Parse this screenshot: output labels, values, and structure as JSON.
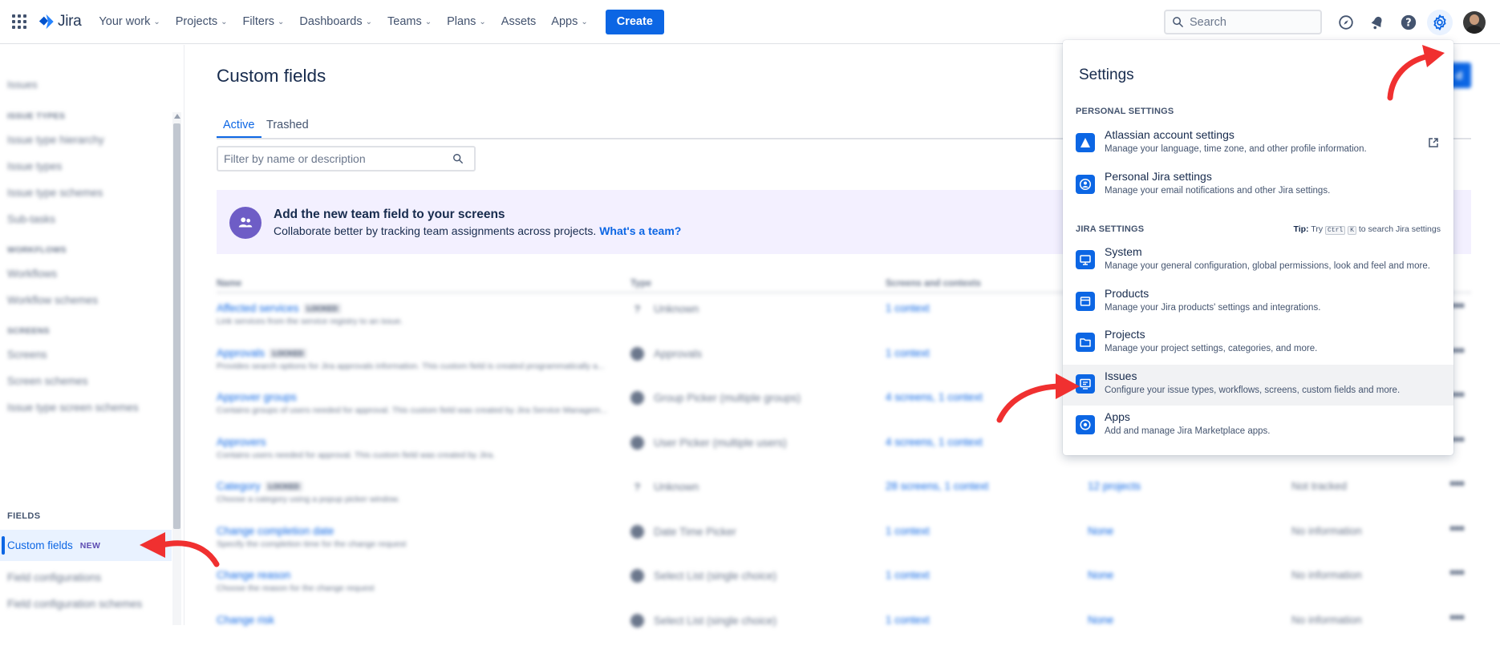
{
  "topnav": {
    "logo_text": "Jira",
    "items": [
      {
        "label": "Your work",
        "chevron": true
      },
      {
        "label": "Projects",
        "chevron": true
      },
      {
        "label": "Filters",
        "chevron": true
      },
      {
        "label": "Dashboards",
        "chevron": true
      },
      {
        "label": "Teams",
        "chevron": true
      },
      {
        "label": "Plans",
        "chevron": true
      },
      {
        "label": "Assets",
        "chevron": false
      },
      {
        "label": "Apps",
        "chevron": true
      }
    ],
    "create_label": "Create",
    "search_placeholder": "Search"
  },
  "sidebar": {
    "title": "Issues",
    "groups": [
      {
        "label": "ISSUE TYPES",
        "links": [
          "Issue type hierarchy",
          "Issue types",
          "Issue type schemes",
          "Sub-tasks"
        ]
      },
      {
        "label": "WORKFLOWS",
        "links": [
          "Workflows",
          "Workflow schemes"
        ]
      },
      {
        "label": "SCREENS",
        "links": [
          "Screens",
          "Screen schemes",
          "Issue type screen schemes"
        ]
      }
    ],
    "fields_label": "FIELDS",
    "active_label": "Custom fields",
    "active_badge": "NEW",
    "after_links": [
      "Field configurations",
      "Field configuration schemes"
    ]
  },
  "main": {
    "title": "Custom fields",
    "tabs": [
      "Active",
      "Trashed"
    ],
    "filter_placeholder": "Filter by name or description",
    "banner": {
      "title": "Add the new team field to your screens",
      "desc": "Collaborate better by tracking team assignments across projects.",
      "link": "What's a team?"
    },
    "columns": [
      "Name",
      "Type",
      "Screens and contexts"
    ],
    "rows": [
      {
        "name": "Affected services",
        "locked": "LOCKED",
        "desc": "Link services from the service registry to an issue.",
        "type": "Unknown",
        "ctx": "1 context",
        "proj": "",
        "last": ""
      },
      {
        "name": "Approvals",
        "locked": "LOCKED",
        "desc": "Provides search options for Jira approvals information. This custom field is created programmatically a...",
        "type": "Approvals",
        "ctx": "1 context",
        "proj": "",
        "last": ""
      },
      {
        "name": "Approver groups",
        "locked": "",
        "desc": "Contains groups of users needed for approval. This custom field was created by Jira Service Managem...",
        "type": "Group Picker (multiple groups)",
        "ctx": "4 screens, 1 context",
        "proj": "",
        "last": ""
      },
      {
        "name": "Approvers",
        "locked": "",
        "desc": "Contains users needed for approval. This custom field was created by Jira.",
        "type": "User Picker (multiple users)",
        "ctx": "4 screens, 1 context",
        "proj": "",
        "last": ""
      },
      {
        "name": "Category",
        "locked": "LOCKED",
        "desc": "Choose a category using a popup picker window.",
        "type": "Unknown",
        "ctx": "28 screens, 1 context",
        "proj": "12 projects",
        "last": "Not tracked"
      },
      {
        "name": "Change completion date",
        "locked": "",
        "desc": "Specify the completion time for the change request",
        "type": "Date Time Picker",
        "ctx": "1 context",
        "proj": "None",
        "last": "No information"
      },
      {
        "name": "Change reason",
        "locked": "",
        "desc": "Choose the reason for the change request",
        "type": "Select List (single choice)",
        "ctx": "1 context",
        "proj": "None",
        "last": "No information"
      },
      {
        "name": "Change risk",
        "locked": "",
        "desc": "",
        "type": "Select List (single choice)",
        "ctx": "1 context",
        "proj": "None",
        "last": "No information"
      }
    ]
  },
  "settings": {
    "title": "Settings",
    "personal_label": "PERSONAL SETTINGS",
    "jira_label": "JIRA SETTINGS",
    "tip_prefix": "Tip:",
    "tip_text_1": "Try",
    "tip_key_1": "Ctrl",
    "tip_key_2": "K",
    "tip_text_2": "to search Jira settings",
    "personal_items": [
      {
        "title": "Atlassian account settings",
        "desc": "Manage your language, time zone, and other profile information.",
        "icon": "atlassian-icon",
        "external": true
      },
      {
        "title": "Personal Jira settings",
        "desc": "Manage your email notifications and other Jira settings.",
        "icon": "person-circle-icon",
        "external": false
      }
    ],
    "jira_items": [
      {
        "title": "System",
        "desc": "Manage your general configuration, global permissions, look and feel and more.",
        "icon": "monitor-icon"
      },
      {
        "title": "Products",
        "desc": "Manage your Jira products' settings and integrations.",
        "icon": "window-icon"
      },
      {
        "title": "Projects",
        "desc": "Manage your project settings, categories, and more.",
        "icon": "folder-icon"
      },
      {
        "title": "Issues",
        "desc": "Configure your issue types, workflows, screens, custom fields and more.",
        "icon": "issue-screen-icon"
      },
      {
        "title": "Apps",
        "desc": "Add and manage Jira Marketplace apps.",
        "icon": "apps-icon"
      }
    ],
    "highlighted": "Issues"
  },
  "colors": {
    "accent": "#0c66e4",
    "annotation_arrow": "#f03030",
    "banner_bg": "#f3f0ff"
  }
}
